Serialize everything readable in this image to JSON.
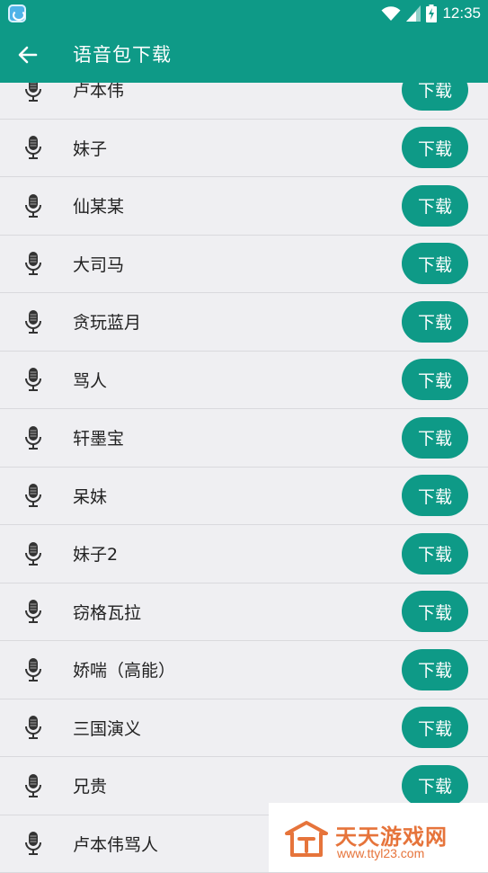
{
  "status_bar": {
    "time": "12:35",
    "icons": [
      "app-notification-icon",
      "wifi-icon",
      "signal-icon",
      "battery-charging-icon"
    ]
  },
  "app_bar": {
    "title": "语音包下载",
    "back_icon": "arrow-left-icon"
  },
  "list": {
    "download_label": "下载",
    "item_icon": "microphone-icon",
    "items": [
      {
        "name": "卢本伟"
      },
      {
        "name": "妹子"
      },
      {
        "name": "仙某某"
      },
      {
        "name": "大司马"
      },
      {
        "name": "贪玩蓝月"
      },
      {
        "name": "骂人"
      },
      {
        "name": "轩墨宝"
      },
      {
        "name": "呆妹"
      },
      {
        "name": "妹子2"
      },
      {
        "name": "窃格瓦拉"
      },
      {
        "name": "娇喘（高能）"
      },
      {
        "name": "三国演义"
      },
      {
        "name": "兄贵"
      },
      {
        "name": "卢本伟骂人"
      }
    ]
  },
  "watermark": {
    "brand": "天天游戏网",
    "url": "www.ttyl23.com"
  },
  "colors": {
    "primary": "#0e9a87",
    "background": "#efeff2",
    "watermark": "#e6743b"
  }
}
